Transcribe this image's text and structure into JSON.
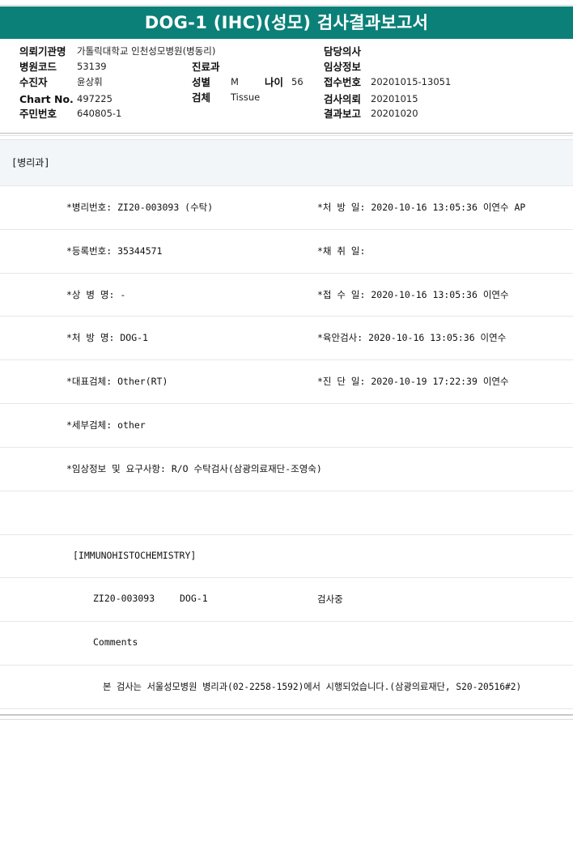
{
  "title": "DOG-1 (IHC)(성모) 검사결과보고서",
  "header": {
    "inst_label": "의뢰기관명",
    "inst_value": "가톨릭대학교 인천성모병원(병동리)",
    "doctor_label": "담당의사",
    "code_label": "병원코드",
    "code_value": "53139",
    "dept_label": "진료과",
    "clinical_label": "임상정보",
    "patient_label": "수진자",
    "patient_value": "윤상휘",
    "sex_label": "성별",
    "sex_value": "M",
    "age_label": "나이",
    "age_value": "56",
    "receipt_label": "접수번호",
    "receipt_value": "20201015-13051",
    "chart_label": "Chart No.",
    "chart_value": "497225",
    "specimen_label": "검체",
    "specimen_value": "Tissue",
    "request_label": "검사의뢰",
    "request_value": "20201015",
    "ssn_label": "주민번호",
    "ssn_value": "640805-1",
    "report_label": "결과보고",
    "report_value": "20201020"
  },
  "report": {
    "department": "[병리과]",
    "rows": [
      {
        "left": "*병리번호: ZI20-003093 (수탁)",
        "right": "*처 방 일: 2020-10-16 13:05:36  이연수 AP"
      },
      {
        "left": "*등록번호: 35344571",
        "right": "*채 취 일:"
      },
      {
        "left": "*상 병 명: -",
        "right": "*접 수 일: 2020-10-16 13:05:36  이연수"
      },
      {
        "left": "*처 방 명: DOG-1",
        "right": "*육안검사: 2020-10-16 13:05:36  이연수"
      },
      {
        "left": "*대표검체: Other(RT)",
        "right": "*진 단 일: 2020-10-19 17:22:39  이연수"
      },
      {
        "left": "*세부검체: other",
        "right": ""
      },
      {
        "left": "*임상정보 및 요구사항: R/O 수탁검사(삼광의료재단-조영숙)",
        "right": ""
      }
    ],
    "section": "[IMMUNOHISTOCHEMISTRY]",
    "result_id": "ZI20-003093",
    "result_test": "DOG-1",
    "result_status": "검사중",
    "comments_label": "Comments",
    "note": "본 검사는 서울성모병원 병리과(02-2258-1592)에서 시행되었습니다.(삼광의료재단, S20-20516#2)"
  }
}
